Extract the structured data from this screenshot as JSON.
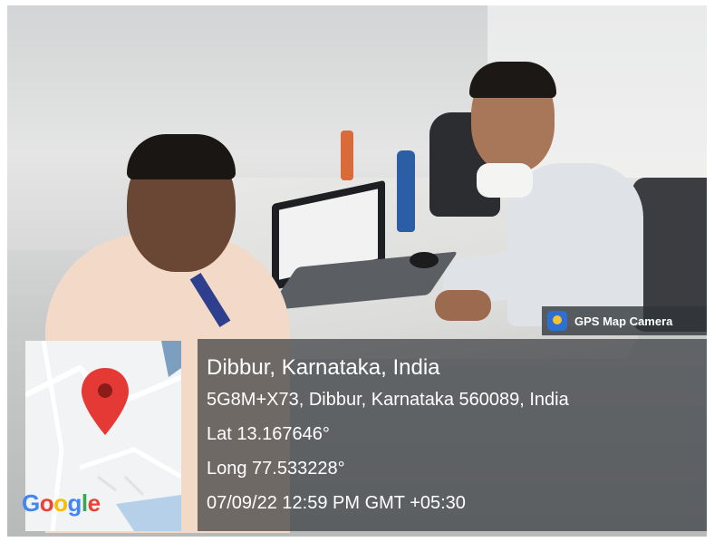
{
  "location": {
    "title": "Dibbur, Karnataka, India",
    "address": "5G8M+X73, Dibbur, Karnataka 560089, India",
    "lat": "Lat 13.167646°",
    "long": "Long 77.533228°",
    "timestamp": "07/09/22 12:59 PM GMT +05:30"
  },
  "badge": {
    "label": "GPS Map Camera",
    "icon": "gps-map-camera-icon"
  },
  "map": {
    "logo": [
      "G",
      "o",
      "o",
      "g",
      "l",
      "e"
    ],
    "pin_color": "#e53935"
  },
  "colors": {
    "panel": "#303438",
    "accent": "#2f6fd1"
  }
}
